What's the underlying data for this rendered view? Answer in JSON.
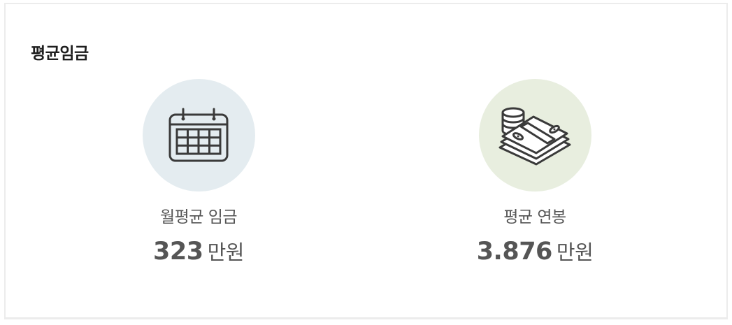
{
  "section": {
    "title": "평균임금"
  },
  "stats": [
    {
      "label": "월평균 임금",
      "value": "323",
      "unit": "만원",
      "icon": "calendar-icon",
      "circle_color": "#e4ecf0"
    },
    {
      "label": "평균 연봉",
      "value": "3.876",
      "unit": "만원",
      "icon": "money-stack-icon",
      "circle_color": "#e8eedf"
    }
  ],
  "colors": {
    "title_text": "#1e1e1e",
    "stat_text": "#555555",
    "icon_stroke": "#3a3a3a",
    "card_border": "#ececec"
  }
}
